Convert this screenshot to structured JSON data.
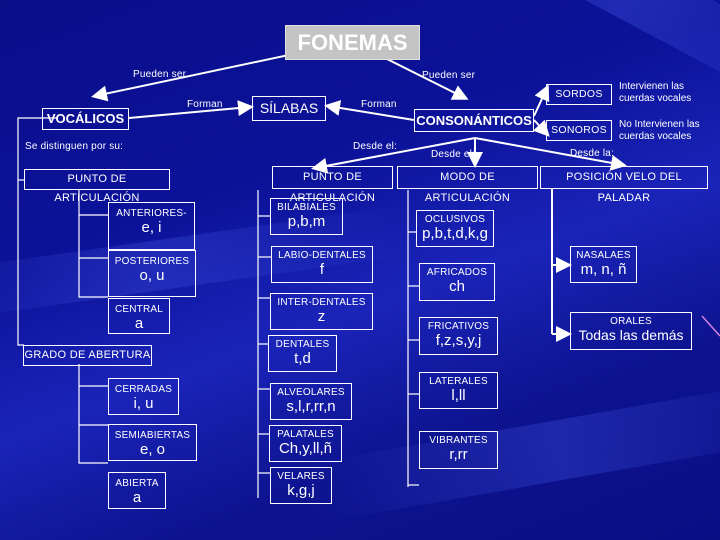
{
  "title": "FONEMAS",
  "connectors": {
    "pueden_ser_left": "Pueden ser",
    "pueden_ser_right": "Pueden ser",
    "forman_left": "Forman",
    "forman_right": "Forman",
    "se_distinguen": "Se distinguen por su:",
    "desde_el_1": "Desde el:",
    "desde_el_2": "Desde el:",
    "desde_la": "Desde la:"
  },
  "silabas": "SÍLABAS",
  "vocalicos": {
    "label": "VOCÁLICOS",
    "punto": {
      "label": "PUNTO DE ARTICULACIÓN",
      "items": [
        {
          "title": "ANTERIORES-",
          "value": "e, i"
        },
        {
          "title": "POSTERIORES",
          "value": "o, u"
        },
        {
          "title": "CENTRAL",
          "value": "a"
        }
      ]
    },
    "grado": {
      "label": "GRADO DE ABERTURA",
      "items": [
        {
          "title": "CERRADAS",
          "value": "i, u"
        },
        {
          "title": "SEMIABIERTAS",
          "value": "e, o"
        },
        {
          "title": "ABIERTA",
          "value": "a"
        }
      ]
    }
  },
  "consonanticos": {
    "label": "CONSONÁNTICOS",
    "sordos": {
      "label": "SORDOS",
      "note": "Intervienen las cuerdas vocales"
    },
    "sonoros": {
      "label": "SONOROS",
      "note": "No Intervienen las cuerdas vocales"
    },
    "punto": {
      "label": "PUNTO DE ARTICULACIÓN",
      "items": [
        {
          "title": "BILABIALES",
          "value": "p,b,m"
        },
        {
          "title": "LABIO-DENTALES",
          "value": "f"
        },
        {
          "title": "INTER-DENTALES",
          "value": "z"
        },
        {
          "title": "DENTALES",
          "value": "t,d"
        },
        {
          "title": "ALVEOLARES",
          "value": "s,l,r,rr,n"
        },
        {
          "title": "PALATALES",
          "value": "Ch,y,ll,ñ"
        },
        {
          "title": "VELARES",
          "value": "k,g,j"
        }
      ]
    },
    "modo": {
      "label": "MODO DE ARTICULACIÓN",
      "items": [
        {
          "title": "OCLUSIVOS",
          "value": "p,b,t,d,k,g"
        },
        {
          "title": "AFRICADOS",
          "value": "ch"
        },
        {
          "title": "FRICATIVOS",
          "value": "f,z,s,y,j"
        },
        {
          "title": "LATERALES",
          "value": "l,ll"
        },
        {
          "title": "VIBRANTES",
          "value": "r,rr"
        }
      ]
    },
    "velo": {
      "label": "POSICIÓN VELO DEL PALADAR",
      "items": [
        {
          "title": "NASALAES",
          "value": "m, n, ñ"
        },
        {
          "title": "ORALES",
          "value": "Todas las demás"
        }
      ]
    }
  }
}
